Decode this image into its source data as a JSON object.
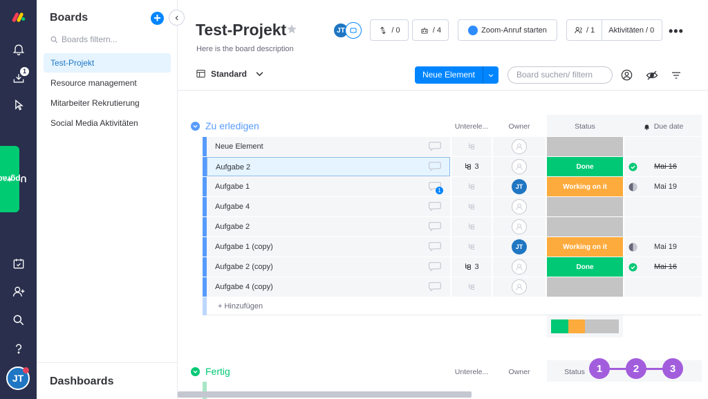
{
  "rail": {
    "inbox_badge": "1",
    "upgrade_label": "Upgrade",
    "avatar_initials": "JT"
  },
  "panel": {
    "title": "Boards",
    "filter_placeholder": "Boards filtern...",
    "boards": [
      {
        "label": "Test-Projekt",
        "active": true
      },
      {
        "label": "Resource management",
        "active": false
      },
      {
        "label": "Mitarbeiter Rekrutierung",
        "active": false
      },
      {
        "label": "Social Media Aktivitäten",
        "active": false
      }
    ],
    "dashboards_label": "Dashboards"
  },
  "header": {
    "project_title": "Test-Projekt",
    "description": "Here is the board description",
    "avatar_initials": "JT",
    "integrations_count": "/ 0",
    "automations_count": "/ 4",
    "zoom_label": "Zoom-Anruf starten",
    "members_count": "/ 1",
    "activity_label": "Aktivitäten / 0",
    "more_label": "•••",
    "view_label": "Standard",
    "new_item_label": "Neue Element",
    "search_placeholder": "Board suchen/ filtern"
  },
  "columns": {
    "subitems": "Unterele...",
    "owner": "Owner",
    "status": "Status",
    "due_date": "Due date"
  },
  "groups": [
    {
      "title": "Zu erledigen",
      "color": "#579bfc",
      "rows": [
        {
          "name": "Neue Element",
          "subitems": "",
          "owner": "",
          "status": "",
          "status_type": "empty",
          "due": "",
          "due_icon": "",
          "strike": false,
          "comment_badge": ""
        },
        {
          "name": "Aufgabe 2",
          "subitems": "3",
          "owner": "",
          "status": "Done",
          "status_type": "done",
          "due": "Mai 16",
          "due_icon": "check",
          "strike": true,
          "comment_badge": ""
        },
        {
          "name": "Aufgabe 1",
          "subitems": "",
          "owner": "JT",
          "status": "Working on it",
          "status_type": "working",
          "due": "Mai 19",
          "due_icon": "clock",
          "strike": false,
          "comment_badge": "1"
        },
        {
          "name": "Aufgabe 4",
          "subitems": "",
          "owner": "",
          "status": "",
          "status_type": "empty",
          "due": "",
          "due_icon": "",
          "strike": false,
          "comment_badge": ""
        },
        {
          "name": "Aufgabe 2",
          "subitems": "",
          "owner": "",
          "status": "",
          "status_type": "empty",
          "due": "",
          "due_icon": "",
          "strike": false,
          "comment_badge": ""
        },
        {
          "name": "Aufgabe 1 (copy)",
          "subitems": "",
          "owner": "JT",
          "status": "Working on it",
          "status_type": "working",
          "due": "Mai 19",
          "due_icon": "clock",
          "strike": false,
          "comment_badge": ""
        },
        {
          "name": "Aufgabe 2 (copy)",
          "subitems": "3",
          "owner": "",
          "status": "Done",
          "status_type": "done",
          "due": "Mai 16",
          "due_icon": "check",
          "strike": true,
          "comment_badge": ""
        },
        {
          "name": "Aufgabe 4 (copy)",
          "subitems": "",
          "owner": "",
          "status": "",
          "status_type": "empty",
          "due": "",
          "due_icon": "",
          "strike": false,
          "comment_badge": ""
        }
      ],
      "add_label": "+ Hinzufügen",
      "status_summary": {
        "done": 0.25,
        "working": 0.25,
        "empty": 0.5
      }
    },
    {
      "title": "Fertig",
      "color": "#00c875"
    }
  ],
  "steps": [
    "1",
    "2",
    "3"
  ],
  "colors": {
    "rail": "#292f4c",
    "accent": "#0085ff",
    "done": "#00c875",
    "working": "#fdab3d",
    "empty": "#c4c4c4",
    "step": "#a25ddc"
  }
}
